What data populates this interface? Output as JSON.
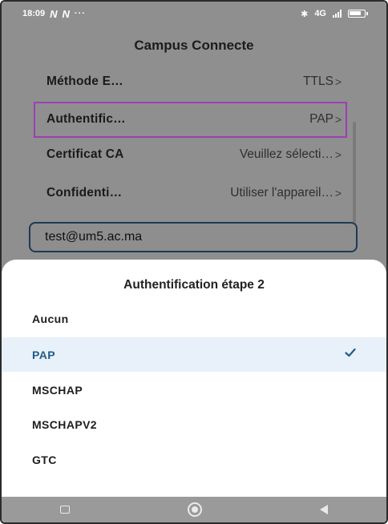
{
  "status_bar": {
    "time": "18:09",
    "indicators": [
      "N",
      "N"
    ],
    "more": "···",
    "network": "4G",
    "battery_level": 0.8
  },
  "screen_title": "Campus Connecte",
  "settings": [
    {
      "label": "Méthode E…",
      "value": "TTLS"
    },
    {
      "label": "Authentific…",
      "value": "PAP"
    },
    {
      "label": "Certificat CA",
      "value": "Veuillez sélecti…"
    },
    {
      "label": "Confidenti…",
      "value": "Utiliser l'appareil…"
    }
  ],
  "identity_field": {
    "value": "test@um5.ac.ma"
  },
  "sheet": {
    "title": "Authentification étape 2",
    "options": [
      "Aucun",
      "PAP",
      "MSCHAP",
      "MSCHAPV2",
      "GTC"
    ],
    "selected_index": 1
  },
  "colors": {
    "highlight_border": "#9c3fb0",
    "selected_bg": "#e8f1fa",
    "selected_text": "#1f5d86",
    "field_border": "#1d3a55"
  },
  "icons": {
    "chevron": "chevron-right-icon",
    "check": "check-icon",
    "nav": [
      "recents-icon",
      "home-icon",
      "back-icon"
    ]
  }
}
